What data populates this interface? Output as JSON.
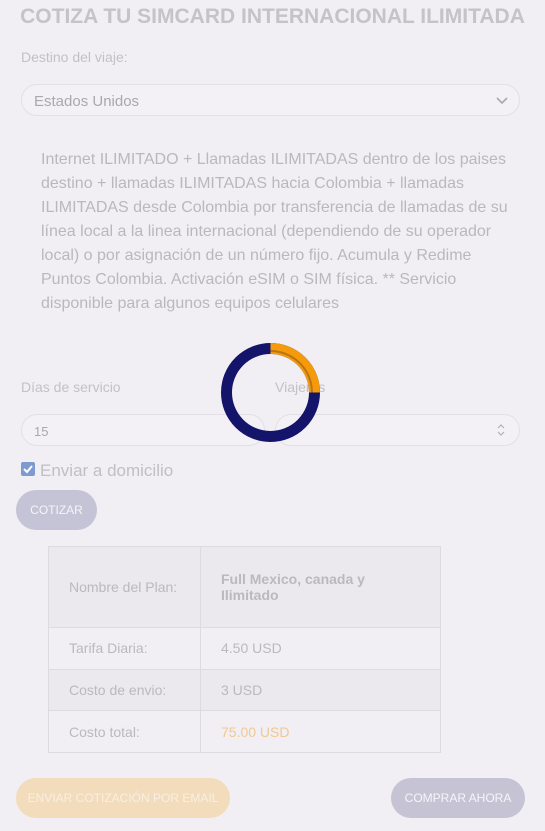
{
  "title": "COTIZA TU SIMCARD INTERNACIONAL ILIMITADA",
  "destino": {
    "label": "Destino del viaje:",
    "selected": "Estados Unidos"
  },
  "description": "Internet ILIMITADO + Llamadas ILIMITADAS dentro de los paises destino + llamadas ILIMITADAS hacia Colombia + llamadas ILIMITADAS desde Colombia por transferencia de llamadas de su línea local a la linea internacional (dependiendo de su operador local) o por asignación de un número fijo. Acumula y Redime Puntos Colombia. Activación eSIM o SIM física. ** Servicio disponible para algunos equipos celulares",
  "dias": {
    "label": "Días de servicio",
    "value": "15"
  },
  "viajeros": {
    "label": "Viajeros",
    "value": ""
  },
  "envio": {
    "label": "Enviar a domicilio",
    "checked": true
  },
  "buttons": {
    "cotizar": "COTIZAR",
    "email": "ENVIAR COTIZACIÓN POR EMAIL",
    "comprar": "COMPRAR AHORA"
  },
  "summary": [
    {
      "label": "Nombre del Plan:",
      "value": "Full Mexico, canada y Ilimitado"
    },
    {
      "label": "Tarifa Diaria:",
      "value": "4.50 USD"
    },
    {
      "label": "Costo de envio:",
      "value": "3 USD"
    },
    {
      "label": "Costo total:",
      "value": "75.00 USD"
    }
  ],
  "colors": {
    "spinner_track": "#13146a",
    "spinner_arc": "#f59a0a",
    "accent_orange": "#f1c893"
  },
  "icons": [
    "chevron-down-icon",
    "spinner-arrows-icon",
    "checkmark-icon",
    "loading-spinner-icon"
  ]
}
